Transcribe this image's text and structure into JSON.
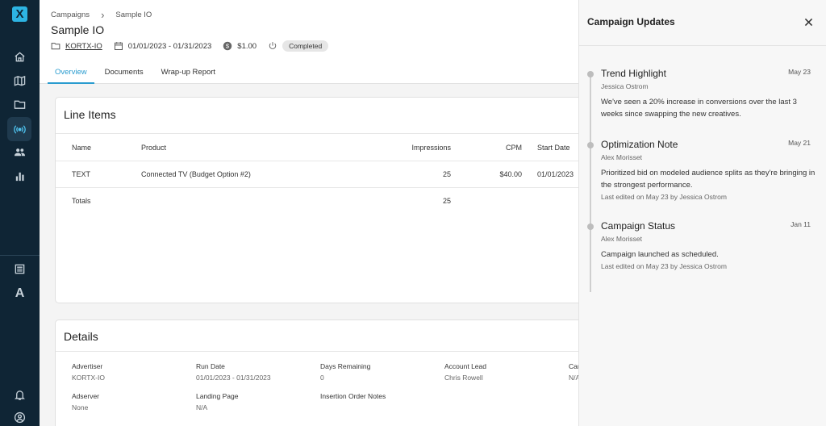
{
  "app": {
    "logo_letter": "X"
  },
  "sidebar": {
    "items": [
      {
        "name": "home-icon"
      },
      {
        "name": "map-icon"
      },
      {
        "name": "folder-icon"
      },
      {
        "name": "broadcast-icon",
        "active": true
      },
      {
        "name": "people-icon"
      },
      {
        "name": "bar-chart-icon"
      }
    ],
    "bottom_items": [
      {
        "name": "list-icon"
      },
      {
        "name": "letter-a-icon",
        "label": "A"
      },
      {
        "name": "bell-icon"
      },
      {
        "name": "account-icon"
      }
    ]
  },
  "breadcrumb": {
    "root": "Campaigns",
    "current": "Sample IO"
  },
  "page": {
    "title": "Sample IO",
    "io_link": "KORTX-IO",
    "date_range": "01/01/2023 - 01/31/2023",
    "budget": "$1.00",
    "status": "Completed"
  },
  "tabs": [
    {
      "label": "Overview",
      "active": true
    },
    {
      "label": "Documents"
    },
    {
      "label": "Wrap-up Report"
    }
  ],
  "line_items": {
    "title": "Line Items",
    "columns": {
      "name": "Name",
      "product": "Product",
      "impressions": "Impressions",
      "cpm": "CPM",
      "start": "Start Date"
    },
    "rows": [
      {
        "name": "TEXT",
        "product": "Connected TV (Budget Option #2)",
        "impressions": "25",
        "cpm": "$40.00",
        "start": "01/01/2023"
      }
    ],
    "totals": {
      "label": "Totals",
      "impressions": "25"
    }
  },
  "details": {
    "title": "Details",
    "fields": [
      {
        "label": "Advertiser",
        "value": "KORTX-IO"
      },
      {
        "label": "Run Date",
        "value": "01/01/2023 - 01/31/2023"
      },
      {
        "label": "Days Remaining",
        "value": "0"
      },
      {
        "label": "Account Lead",
        "value": "Chris Rowell"
      },
      {
        "label": "Car",
        "value": "N/A"
      },
      {
        "label": "Adserver",
        "value": "None"
      },
      {
        "label": "Landing Page",
        "value": "N/A"
      },
      {
        "label": "Insertion Order Notes",
        "value": ""
      }
    ]
  },
  "panel": {
    "title": "Campaign Updates",
    "updates": [
      {
        "title": "Trend Highlight",
        "date": "May 23",
        "author": "Jessica Ostrom",
        "body": "We've seen a 20% increase in conversions over the last 3 weeks since swapping the new creatives.",
        "edited": ""
      },
      {
        "title": "Optimization Note",
        "date": "May 21",
        "author": "Alex Morisset",
        "body": "Prioritized bid on modeled audience splits as they're bringing in the strongest performance.",
        "edited": "Last edited on May 23 by Jessica Ostrom"
      },
      {
        "title": "Campaign Status",
        "date": "Jan 11",
        "author": "Alex Morisset",
        "body": "Campaign launched as scheduled.",
        "edited": "Last edited on May 23 by Jessica Ostrom"
      }
    ]
  }
}
